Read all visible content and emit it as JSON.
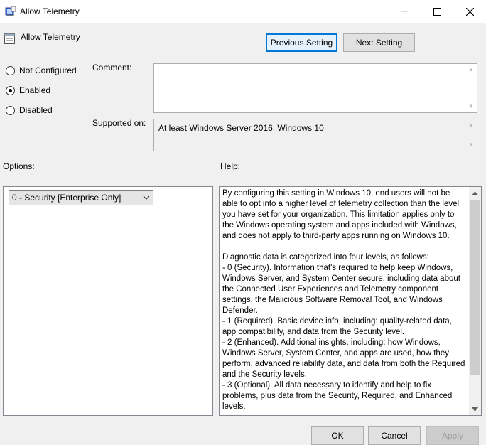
{
  "window": {
    "title": "Allow Telemetry",
    "icons": [
      "policy-icon",
      "minimize-icon",
      "maximize-icon",
      "close-icon"
    ]
  },
  "header": {
    "setting_name": "Allow Telemetry",
    "prev_label": "Previous Setting",
    "next_label": "Next Setting"
  },
  "state": {
    "options": [
      {
        "label": "Not Configured",
        "checked": false
      },
      {
        "label": "Enabled",
        "checked": true
      },
      {
        "label": "Disabled",
        "checked": false
      }
    ]
  },
  "comment": {
    "label": "Comment:",
    "value": ""
  },
  "supported": {
    "label": "Supported on:",
    "value": "At least Windows Server 2016, Windows 10"
  },
  "options_section": {
    "label": "Options:",
    "selected": "0 - Security [Enterprise Only]"
  },
  "help_section": {
    "label": "Help:",
    "text": "By configuring this setting in Windows 10, end users will not be able to opt into a higher level of telemetry collection than the level you have set for your organization.  This limitation applies only to the Windows operating system and apps included with Windows, and does not apply to third-party apps running on Windows 10.\n\nDiagnostic data is categorized into four levels, as follows:\n  - 0 (Security). Information that's required to help keep Windows, Windows Server, and System Center secure, including data about the Connected User Experiences and Telemetry component settings, the Malicious Software Removal Tool, and Windows Defender.\n  - 1 (Required). Basic device info, including: quality-related data, app compatibility, and data from the Security level.\n  - 2 (Enhanced). Additional insights, including: how Windows, Windows Server, System Center, and apps are used, how they perform, advanced reliability data, and data from both the Required and the Security levels.\n  - 3 (Optional). All data necessary to identify and help to fix problems, plus data from the Security, Required, and Enhanced levels."
  },
  "footer": {
    "ok_label": "OK",
    "cancel_label": "Cancel",
    "apply_label": "Apply"
  },
  "colors": {
    "focus_border": "#0078d7",
    "window_bg": "#f0f0f0"
  }
}
